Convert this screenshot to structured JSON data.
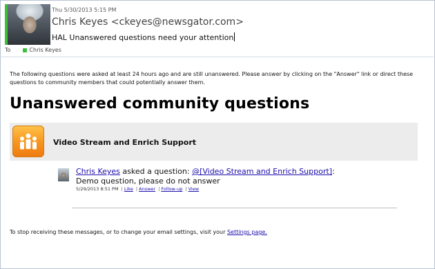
{
  "header": {
    "date": "Thu 5/30/2013 5:15 PM",
    "sender": "Chris Keyes <ckeyes@newsgator.com>",
    "subject": "HAL Unanswered questions need your attention",
    "to_label": "To",
    "to_name": "Chris Keyes",
    "presence_color": "#3dbf3d"
  },
  "body": {
    "intro": "The following questions were asked at least 24 hours ago and are still unanswered. Please answer by clicking on the \"Answer\" link or direct these questions to community members that could potentially answer them.",
    "heading": "Unanswered community questions",
    "group": {
      "name": "Video Stream and Enrich Support",
      "icon": "community-people-icon",
      "icon_color": "#f7941d"
    },
    "question": {
      "author": "Chris Keyes",
      "asked": " asked a question: ",
      "group_link": "@[Video Stream and Enrich Support]",
      "text": ": Demo question, please do not answer",
      "timestamp": "5/29/2013 8:51 PM",
      "actions": [
        "Like",
        "Answer",
        "Follow-up",
        "View"
      ]
    },
    "footer_text": "To stop receiving these messages, or to change your email settings, visit your ",
    "footer_link": "Settings page."
  },
  "colors": {
    "link": "#1a0dab",
    "group_bar": "#ececec"
  }
}
